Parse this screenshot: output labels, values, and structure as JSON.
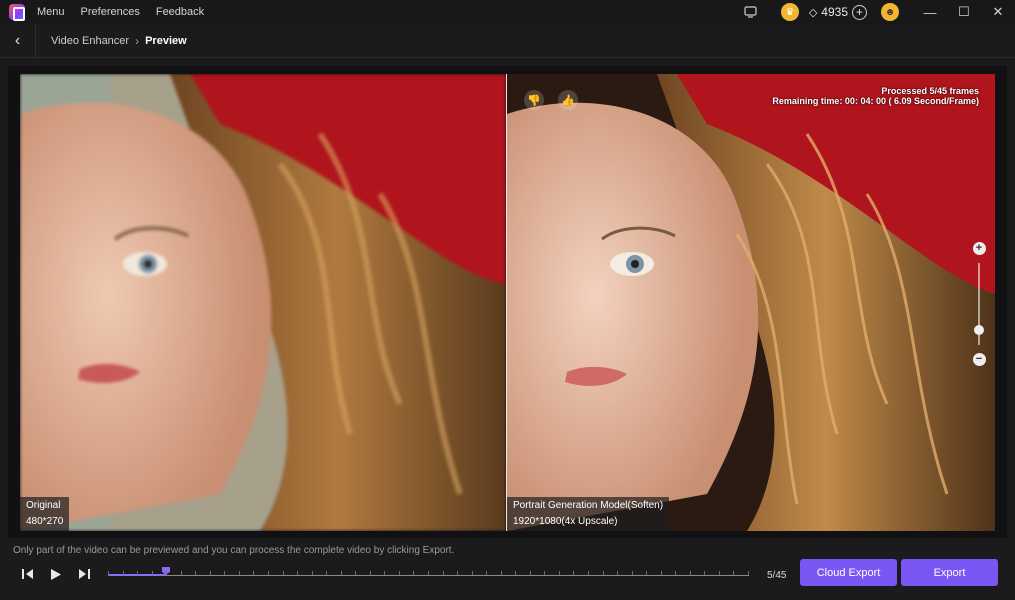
{
  "titlebar": {
    "menu": [
      "Menu",
      "Preferences",
      "Feedback"
    ],
    "credits": "4935"
  },
  "nav": {
    "parent": "Video Enhancer",
    "current": "Preview"
  },
  "preview": {
    "left_tag_title": "Original",
    "left_tag_res": "480*270",
    "right_tag_title": "Portrait Generation Model(Soften)",
    "right_tag_res": "1920*1080(4x Upscale)",
    "processed": "Processed 5/45 frames",
    "remaining": "Remaining time: 00: 04: 00 ( 6.09 Second/Frame)",
    "zoom_level": 0.55
  },
  "footer": {
    "hint": "Only part of the video can be previewed and you can process the complete video by clicking Export.",
    "frame_count": "5/45",
    "progress_fraction": 0.0911,
    "tick_count": 45,
    "cloud_export_label": "Cloud Export",
    "export_label": "Export"
  },
  "colors": {
    "accent": "#7a57f5",
    "hat": "#b0141c",
    "hair": "#8a5a2b",
    "skin": "#e3b49a"
  }
}
